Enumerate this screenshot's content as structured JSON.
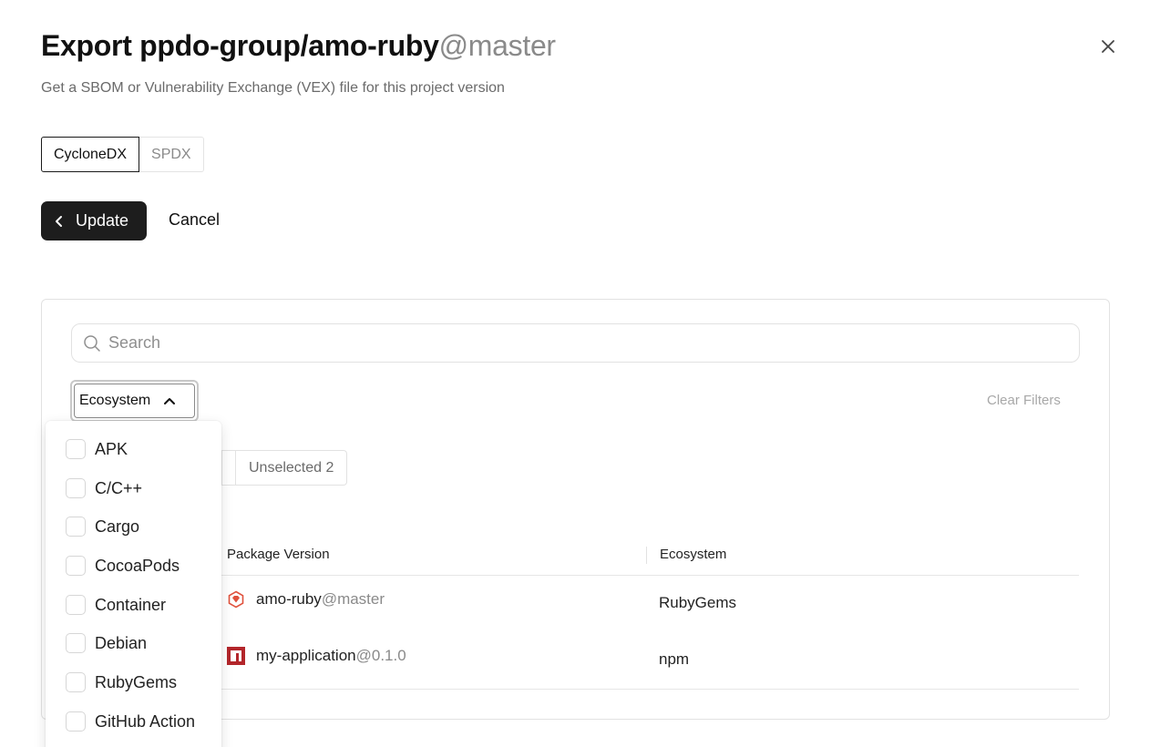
{
  "header": {
    "title_main": "Export ppdo-group/amo-ruby",
    "title_suffix": "@master",
    "subtitle": "Get a SBOM or Vulnerability Exchange (VEX) file for this project version"
  },
  "format_tabs": [
    "CycloneDX",
    "SPDX"
  ],
  "actions": {
    "update_label": "Update",
    "cancel_label": "Cancel"
  },
  "search": {
    "placeholder": "Search"
  },
  "filter": {
    "ecosystem_label": "Ecosystem",
    "clear_label": "Clear Filters"
  },
  "selection_tabs": {
    "unselected_label": "Unselected 2"
  },
  "table": {
    "columns": [
      "Package Version",
      "Ecosystem"
    ],
    "rows": [
      {
        "name": "amo-ruby",
        "version": "@master",
        "ecosystem": "RubyGems",
        "icon": "rubygems-icon"
      },
      {
        "name": "my-application",
        "version": "@0.1.0",
        "ecosystem": "npm",
        "icon": "npm-icon"
      }
    ]
  },
  "ecosystem_options": [
    "APK",
    "C/C++",
    "Cargo",
    "CocoaPods",
    "Container",
    "Debian",
    "RubyGems",
    "GitHub Action"
  ],
  "colors": {
    "primary_button": "#1d1d1d",
    "rubygems": "#e0513c",
    "npm": "#b3262b"
  }
}
